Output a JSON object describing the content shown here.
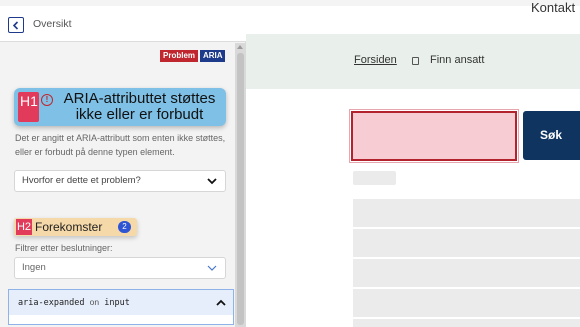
{
  "panel": {
    "title": "Oversikt",
    "badges": {
      "problem": "Problem",
      "aria": "ARIA"
    },
    "heading1": {
      "tag": "H1",
      "icon": "exclamation-circle-icon",
      "text": "ARIA-attributtet støttes ikke eller er forbudt"
    },
    "description": "Det er angitt et ARIA-attributt som enten ikke støttes, eller er forbudt på denne typen element.",
    "why_select": {
      "label": "Hvorfor er dette et problem?"
    },
    "heading2": {
      "tag": "H2",
      "text": "Forekomster",
      "count": "2"
    },
    "filter": {
      "label": "Filtrer etter beslutninger:",
      "value": "Ingen"
    },
    "occurrence": {
      "attribute": "aria-expanded",
      "on": "on",
      "element": "input"
    }
  },
  "site": {
    "top_link": "Kontakt",
    "breadcrumb": {
      "home": "Forsiden",
      "current": "Finn ansatt"
    },
    "search": {
      "value": "",
      "button": "Søk"
    }
  },
  "colors": {
    "badge_problem": "#c0262d",
    "badge_aria": "#1e3a8a",
    "h1_bg": "#7fc0e6",
    "h2_bg": "#f6d9a8",
    "error_border": "#b3232e",
    "search_button": "#0f3460",
    "breadcrumb_bg": "#e9f0eb"
  }
}
